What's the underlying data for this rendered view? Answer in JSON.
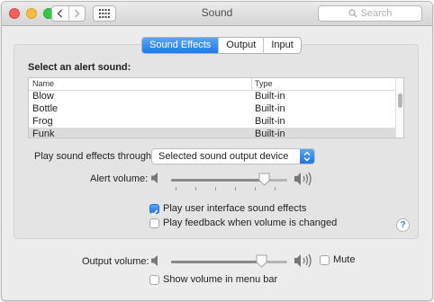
{
  "window": {
    "title": "Sound",
    "search_placeholder": "Search",
    "nav": {
      "back": "back-chevron-icon",
      "forward": "forward-chevron-icon",
      "grid": "grid-icon"
    }
  },
  "tabs": [
    {
      "label": "Sound Effects",
      "active": true
    },
    {
      "label": "Output",
      "active": false
    },
    {
      "label": "Input",
      "active": false
    }
  ],
  "sound_effects": {
    "alert_section_label": "Select an alert sound:",
    "columns": [
      "Name",
      "Type"
    ],
    "rows": [
      {
        "name": "Blow",
        "type": "Built-in",
        "selected": false
      },
      {
        "name": "Bottle",
        "type": "Built-in",
        "selected": false
      },
      {
        "name": "Frog",
        "type": "Built-in",
        "selected": false
      },
      {
        "name": "Funk",
        "type": "Built-in",
        "selected": true
      }
    ],
    "play_through_label": "Play sound effects through:",
    "play_through_value": "Selected sound output device",
    "alert_volume_label": "Alert volume:",
    "alert_volume_level": 0.8,
    "play_ui_sounds_label": "Play user interface sound effects",
    "play_ui_sounds_checked": true,
    "feedback_label": "Play feedback when volume is changed",
    "feedback_checked": false,
    "help_label": "?"
  },
  "output_volume": {
    "label": "Output volume:",
    "level": 0.78,
    "mute_label": "Mute",
    "mute_checked": false,
    "menu_bar_label": "Show volume in menu bar",
    "menu_bar_checked": false
  },
  "colors": {
    "accent": "#2879e8",
    "selected_row": "#dcdcdc",
    "panel": "#e4e4e4",
    "window": "#ececec"
  }
}
